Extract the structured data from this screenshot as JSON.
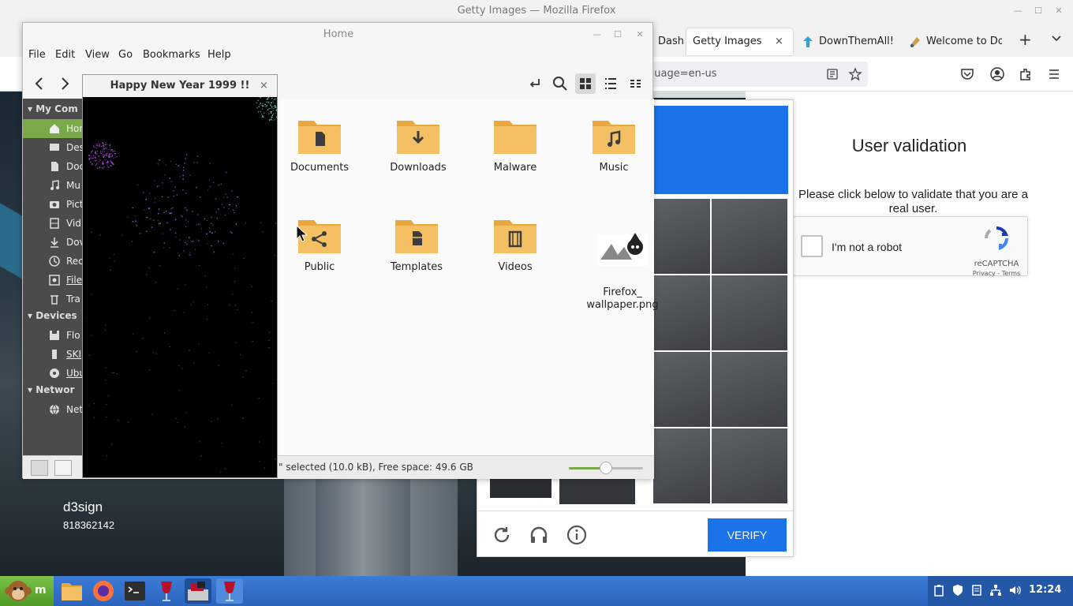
{
  "firefox": {
    "window_title": "Getty Images — Mozilla Firefox",
    "tabs": [
      {
        "label": "Dash",
        "icon": "dashboard-icon"
      },
      {
        "label": "Getty Images",
        "close": "×",
        "active": true
      },
      {
        "label": "DownThemAll!",
        "icon": "downthemall-icon"
      },
      {
        "label": "Welcome to Do",
        "icon": "welcome-icon"
      }
    ],
    "new_tab": "+",
    "url_fragment": "guage=en-us"
  },
  "page": {
    "validation_title": "User validation",
    "validation_desc": "Please click below to validate that you are a real user.",
    "recaptcha_label": "I'm not a robot",
    "recaptcha_brand": "reCAPTCHA",
    "recaptcha_links": "Privacy - Terms",
    "verify_label": "VERIFY"
  },
  "desktop": {
    "label": "d3sign",
    "number": "818362142"
  },
  "nemo": {
    "title": "Home",
    "menu": [
      "File",
      "Edit",
      "View",
      "Go",
      "Bookmarks",
      "Help"
    ],
    "sidebar": {
      "sections": [
        "My Com",
        "Devices",
        "Networ"
      ],
      "items_my_computer": [
        "Hom",
        "Des",
        "Doc",
        "Mu",
        "Pict",
        "Vid",
        "Dov",
        "Rec",
        "File",
        "Tra"
      ],
      "items_devices": [
        "Flo",
        "SKI",
        "Ubu"
      ],
      "items_network": [
        "Net"
      ]
    },
    "folders": [
      {
        "name": "Documents",
        "icon": "folder-documents-icon"
      },
      {
        "name": "Downloads",
        "icon": "folder-downloads-icon"
      },
      {
        "name": "Malware",
        "icon": "folder-icon"
      },
      {
        "name": "Music",
        "icon": "folder-music-icon"
      },
      {
        "name": "Public",
        "icon": "folder-public-icon"
      },
      {
        "name": "Templates",
        "icon": "folder-templates-icon"
      },
      {
        "name": "Videos",
        "icon": "folder-videos-icon"
      },
      {
        "name": "Firefox_\nwallpaper.png",
        "icon": "image-thumbnail-icon"
      }
    ],
    "status": "\" selected (10.0 kB), Free space: 49.6 GB",
    "zoom_fraction": 0.5
  },
  "xsnow": {
    "title": "Happy New Year 1999 !!",
    "close": "×"
  },
  "taskbar": {
    "menu_label": "m",
    "clock": "12:24"
  },
  "colors": {
    "accent": "#1a73e8",
    "folder": "#f5c063",
    "sidebar_selected": "#7aa94a",
    "taskbar": "#2a64bd"
  }
}
